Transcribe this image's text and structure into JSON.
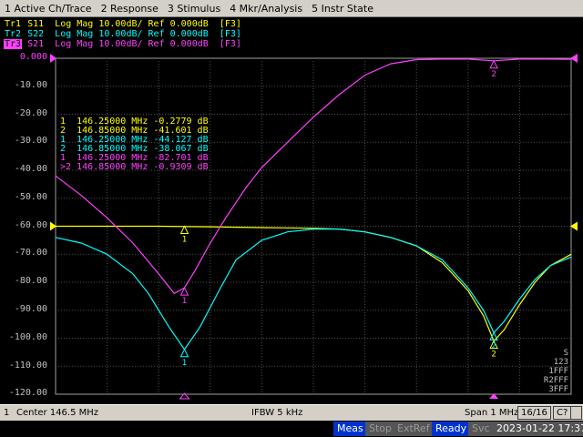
{
  "menu": [
    "1 Active Ch/Trace",
    "2 Response",
    "3 Stimulus",
    "4 Mkr/Analysis",
    "5 Instr State"
  ],
  "traces": [
    {
      "tag": "Tr1",
      "text": " S11  Log Mag 10.00dB/ Ref 0.000dB  [F3]",
      "color": "#ffff00"
    },
    {
      "tag": "Tr2",
      "text": " S22  Log Mag 10.00dB/ Ref 0.000dB  [F3]",
      "color": "#00ffff"
    },
    {
      "tag": "Tr3",
      "text": " S21  Log Mag 10.00dB/ Ref 0.000dB  [F3]",
      "color": "#ff40ff"
    }
  ],
  "y_labels": [
    "0.000",
    "-10.00",
    "-20.00",
    "-30.00",
    "-40.00",
    "-50.00",
    "-60.00",
    "-70.00",
    "-80.00",
    "-90.00",
    "-100.00",
    "-110.00",
    "-120.00"
  ],
  "marker_table": [
    {
      "num": "1",
      "freq": "146.25000 MHz",
      "value": "-0.2779 dB",
      "color": "#ffff00"
    },
    {
      "num": "2",
      "freq": "146.85000 MHz",
      "value": "-41.601 dB",
      "color": "#ffff00"
    },
    {
      "num": "1",
      "freq": "146.25000 MHz",
      "value": "-44.127 dB",
      "color": "#00ffff"
    },
    {
      "num": "2",
      "freq": "146.85000 MHz",
      "value": "-38.067 dB",
      "color": "#00ffff"
    },
    {
      "num": "1",
      "freq": "146.25000 MHz",
      "value": "-82.701 dB",
      "color": "#ff40ff"
    },
    {
      "num": ">2",
      "freq": "146.85000 MHz",
      "value": "-0.9309 dB",
      "color": "#ff40ff"
    }
  ],
  "side_labels": [
    "S",
    "123",
    "1FFF",
    "R2FFF",
    "3FFF"
  ],
  "chart_data": {
    "type": "line",
    "x_start_mhz": 146.0,
    "x_stop_mhz": 147.0,
    "ylim": [
      -120,
      0
    ],
    "grid": true,
    "series": [
      {
        "name": "S11",
        "color": "#ffff00",
        "x": [
          146.0,
          146.1,
          146.2,
          146.3,
          146.4,
          146.45,
          146.5,
          146.55,
          146.6,
          146.65,
          146.7,
          146.75,
          146.8,
          146.83,
          146.85,
          146.87,
          146.9,
          146.93,
          146.96,
          147.0
        ],
        "y": [
          -60,
          -60,
          -60,
          -60.2,
          -60.5,
          -60.6,
          -60.7,
          -61,
          -62,
          -64,
          -67,
          -73,
          -83,
          -92,
          -101,
          -97,
          -88,
          -80,
          -74,
          -70
        ]
      },
      {
        "name": "S22",
        "color": "#00ffff",
        "x": [
          146.0,
          146.05,
          146.1,
          146.15,
          146.18,
          146.22,
          146.25,
          146.28,
          146.32,
          146.35,
          146.4,
          146.45,
          146.5,
          146.55,
          146.6,
          146.65,
          146.7,
          146.75,
          146.8,
          146.83,
          146.85,
          146.87,
          146.9,
          146.93,
          146.96,
          147.0
        ],
        "y": [
          -64,
          -66,
          -70,
          -77,
          -84,
          -96,
          -104,
          -96,
          -82,
          -72,
          -65,
          -62,
          -61,
          -61,
          -62,
          -64,
          -67,
          -72,
          -82,
          -90,
          -98,
          -94,
          -86,
          -79,
          -74,
          -71
        ]
      },
      {
        "name": "S21",
        "color": "#ff40ff",
        "x": [
          146.0,
          146.05,
          146.1,
          146.15,
          146.2,
          146.23,
          146.25,
          146.27,
          146.3,
          146.33,
          146.37,
          146.4,
          146.45,
          146.5,
          146.55,
          146.6,
          146.65,
          146.7,
          146.75,
          146.8,
          146.85,
          146.9,
          146.95,
          147.0
        ],
        "y": [
          -42,
          -49,
          -57,
          -66,
          -77,
          -84,
          -82,
          -76,
          -66,
          -57,
          -46,
          -39,
          -30,
          -21,
          -13,
          -6,
          -2,
          -0.5,
          -0.3,
          -0.3,
          -0.9,
          -0.3,
          -0.3,
          -0.4
        ]
      }
    ],
    "markers": [
      {
        "num": "1",
        "series": "S11",
        "x": 146.25,
        "y": -60
      },
      {
        "num": "2",
        "series": "S11",
        "x": 146.85,
        "y": -101
      },
      {
        "num": "1",
        "series": "S22",
        "x": 146.25,
        "y": -104
      },
      {
        "num": "2",
        "series": "S22",
        "x": 146.85,
        "y": -98
      },
      {
        "num": "1",
        "series": "S21",
        "x": 146.25,
        "y": -82
      },
      {
        "num": "2",
        "series": "S21",
        "x": 146.85,
        "y": -0.9
      }
    ]
  },
  "info": {
    "channel": "1",
    "center": "Center 146.5 MHz",
    "ifbw": "IFBW 5 kHz",
    "span": "Span 1 MHz",
    "points": "16/16",
    "cal": "C?"
  },
  "status": {
    "meas": "Meas",
    "stop": "Stop",
    "extref": "ExtRef",
    "ready": "Ready",
    "svc": "Svc",
    "datetime": "2023-01-22 17:37"
  }
}
